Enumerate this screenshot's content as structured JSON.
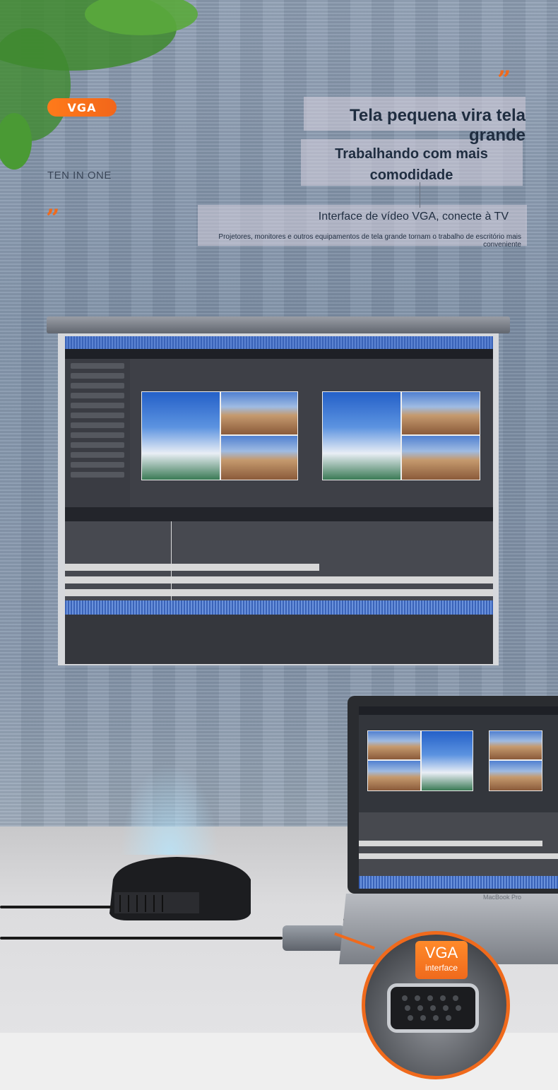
{
  "badge": {
    "label": "VGA"
  },
  "tagline": "TEN IN ONE",
  "quotes": {
    "open": "”",
    "close": "”"
  },
  "headline": {
    "title": "Tela pequena vira tela grande",
    "subtitle_line1": "Trabalhando com mais",
    "subtitle_line2": "comodidade",
    "interface": "Interface de vídeo VGA, conecte à TV",
    "description": "Projetores, monitores e outros equipamentos de tela grande tornam o trabalho de escritório mais conveniente"
  },
  "callout": {
    "big": "VGA",
    "small": "interface"
  },
  "laptop": {
    "brand": "MacBook Pro"
  },
  "colors": {
    "accent": "#f06a1c",
    "text": "#1f2d40",
    "wall": "#8a9aae"
  },
  "icons": [
    "plant-decoration",
    "projector-device",
    "vga-adapter",
    "laptop",
    "vga-port"
  ]
}
